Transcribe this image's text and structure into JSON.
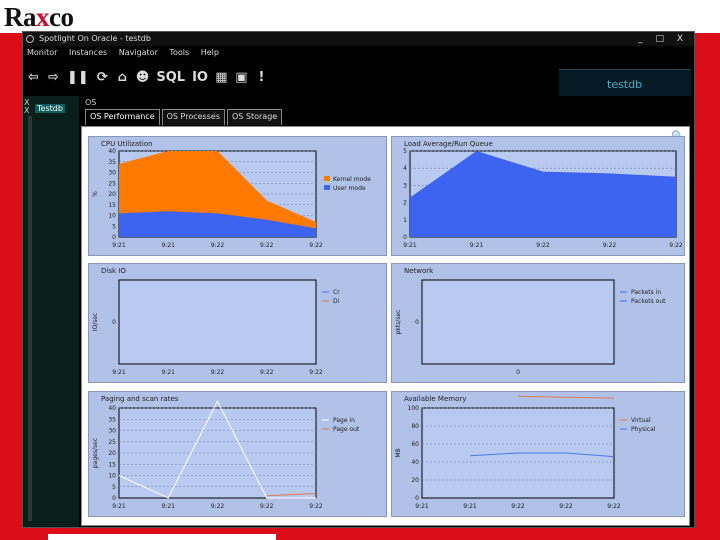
{
  "brand": {
    "logo_r": "Ra",
    "logo_x": "x",
    "logo_rest": "co"
  },
  "window": {
    "title": "Spotlight On Oracle - testdb",
    "controls": "_ □ X"
  },
  "menu": [
    "Monitor",
    "Instances",
    "Navigator",
    "Tools",
    "Help"
  ],
  "toolbar": [
    "back",
    "forward",
    "pause",
    "refresh",
    "home",
    "users",
    "sql",
    "io",
    "memory",
    "connect",
    "alert"
  ],
  "toolbar_text": {
    "sql": "SQL",
    "io": "IO"
  },
  "db_panel": {
    "label": "testdb"
  },
  "sidebar": {
    "node_label": "Testdb",
    "close": "X"
  },
  "main": {
    "label": "OS",
    "tabs": [
      "OS Performance",
      "OS Processes",
      "OS Storage"
    ],
    "active_tab": 0
  },
  "charts": [
    {
      "title": "CPU Utilization",
      "type": "area",
      "ylabel": "%",
      "ylim": [
        0,
        40
      ],
      "yticks": [
        0,
        5,
        10,
        15,
        20,
        25,
        30,
        35,
        40
      ],
      "x": [
        "9:21",
        "9:21",
        "9:22",
        "9:22",
        "9:22"
      ],
      "series": [
        {
          "name": "Kernel mode",
          "color": "#ff7a00",
          "values": [
            34,
            40,
            40,
            17,
            7
          ]
        },
        {
          "name": "User mode",
          "color": "#3c64f0",
          "values": [
            11,
            12,
            11,
            8,
            4
          ]
        }
      ]
    },
    {
      "title": "Load Average/Run Queue",
      "type": "area",
      "ylim": [
        0,
        5
      ],
      "yticks": [
        0,
        1,
        2,
        3,
        4,
        5
      ],
      "x": [
        "9:21",
        "9:21",
        "9:22",
        "9:22",
        "9:22"
      ],
      "series": [
        {
          "name": "",
          "color": "#3c64f0",
          "values": [
            2.3,
            5,
            3.8,
            3.7,
            3.5
          ]
        }
      ]
    },
    {
      "title": "Disk IO",
      "type": "line",
      "ylabel": "IO/sec",
      "ylim": [
        0,
        0
      ],
      "yticks": [
        0
      ],
      "x": [
        "9:21",
        "9:21",
        "9:22",
        "9:22",
        "9:22"
      ],
      "series": [
        {
          "name": "Cr",
          "color": "#4a7ae0",
          "values": []
        },
        {
          "name": "Di",
          "color": "#e07a4a",
          "values": []
        }
      ]
    },
    {
      "title": "Network",
      "type": "line",
      "ylabel": "pkts/sec",
      "ylim": [
        0,
        0
      ],
      "yticks": [
        0
      ],
      "x": [
        "0"
      ],
      "series": [
        {
          "name": "Packets in",
          "color": "#3c64f0",
          "values": []
        },
        {
          "name": "Packets out",
          "color": "#3c64f0",
          "values": []
        }
      ]
    },
    {
      "title": "Paging and scan rates",
      "type": "line",
      "ylabel": "pages/sec",
      "ylim": [
        0,
        40
      ],
      "yticks": [
        0,
        5,
        10,
        15,
        20,
        25,
        30,
        35,
        40
      ],
      "x": [
        "9:21",
        "9:21",
        "9:22",
        "9:22",
        "9:22"
      ],
      "series": [
        {
          "name": "Page in",
          "color": "#ffffff",
          "values": [
            10,
            0,
            43,
            0,
            0
          ]
        },
        {
          "name": "Page out",
          "color": "#e07a4a",
          "values": [
            null,
            null,
            null,
            1,
            2
          ]
        }
      ]
    },
    {
      "title": "Available Memory",
      "type": "line",
      "ylabel": "MB",
      "ylim": [
        0,
        100
      ],
      "yticks": [
        0,
        20,
        40,
        60,
        80,
        100
      ],
      "x": [
        "9:21",
        "9:21",
        "9:22",
        "9:22",
        "9:22"
      ],
      "series": [
        {
          "name": "Virtual",
          "color": "#e07a4a",
          "values": [
            null,
            null,
            113,
            112,
            111
          ]
        },
        {
          "name": "Physical",
          "color": "#4a7ae0",
          "values": [
            null,
            47,
            50,
            50,
            46
          ]
        }
      ]
    }
  ]
}
